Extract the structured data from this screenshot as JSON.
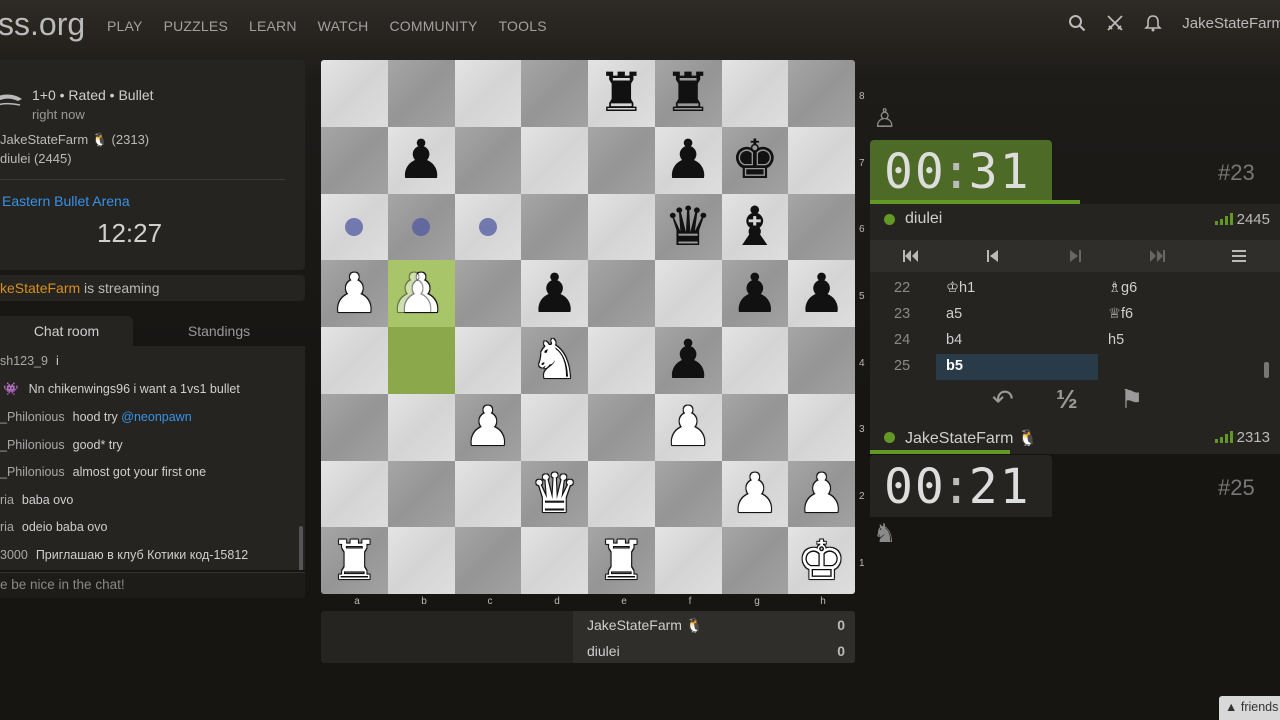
{
  "nav": {
    "logo": "ss.org",
    "links": [
      "PLAY",
      "PUZZLES",
      "LEARN",
      "WATCH",
      "COMMUNITY",
      "TOOLS"
    ],
    "username": "JakeStateFarm"
  },
  "game_info": {
    "type": "1+0 • Rated • Bullet",
    "time": "right now",
    "player1": "JakeStateFarm 🐧 (2313)",
    "player2": "diulei (2445)",
    "arena": "Eastern Bullet Arena",
    "arena_clock": "12:27"
  },
  "streaming": {
    "name": "keStateFarm",
    "text": " is streaming"
  },
  "chat": {
    "tab_chat": "Chat room",
    "tab_standings": "Standings",
    "messages": [
      {
        "user": "sh123_9",
        "text": "i"
      },
      {
        "user": "👾",
        "text": "Nn chikenwings96 i want a 1vs1 bullet"
      },
      {
        "user": "_Philonious",
        "text": "hood try ",
        "mention": "@neonpawn"
      },
      {
        "user": "_Philonious",
        "text": "good* try"
      },
      {
        "user": "_Philonious",
        "text": "almost got your first one"
      },
      {
        "user": "ria",
        "text": "baba ovo"
      },
      {
        "user": "ria",
        "text": "odeio baba ovo"
      },
      {
        "user": "3000",
        "text": "Приглашаю в клуб Котики код-15812"
      }
    ],
    "input_placeholder": "e be nice in the chat!"
  },
  "board": {
    "ranks": [
      "8",
      "7",
      "6",
      "5",
      "4",
      "3",
      "2",
      "1"
    ],
    "files": [
      "a",
      "b",
      "c",
      "d",
      "e",
      "f",
      "g",
      "h"
    ]
  },
  "score": {
    "p1_name": "JakeStateFarm 🐧",
    "p1_pts": "0",
    "p2_name": "diulei",
    "p2_pts": "0"
  },
  "clocks": {
    "top": {
      "min": "00",
      "sec": "31"
    },
    "bottom": {
      "min": "00",
      "sec": "21"
    },
    "top_move": "#23",
    "bottom_move": "#25"
  },
  "players": {
    "top_name": "diulei",
    "top_rating": "2445",
    "bottom_name": "JakeStateFarm 🐧",
    "bottom_rating": "2313"
  },
  "moves": [
    {
      "n": "22",
      "w": "♔h1",
      "b": "♗g6"
    },
    {
      "n": "23",
      "w": "a5",
      "b": "♕f6"
    },
    {
      "n": "24",
      "w": "b4",
      "b": "h5"
    },
    {
      "n": "25",
      "w": "b5",
      "b": ""
    }
  ],
  "actions": {
    "takeback": "↶",
    "draw": "½",
    "resign": "⚑"
  },
  "captured": {
    "top": "♙",
    "bottom": "♞"
  },
  "friends": "▲ friends"
}
